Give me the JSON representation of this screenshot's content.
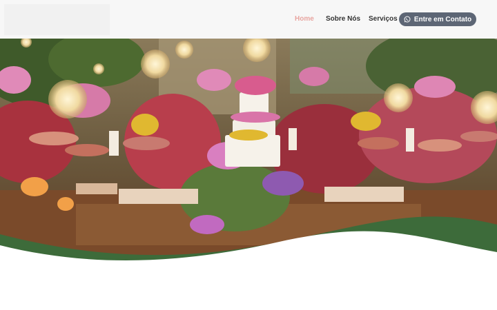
{
  "header": {
    "logo_alt": "",
    "nav": {
      "home": "Home",
      "about": "Sobre Nós",
      "services": "Serviços"
    },
    "cta_label": "Entre em Contato",
    "cta_icon": "whatsapp-icon"
  },
  "hero": {
    "image_description_icon": "event-table-photo",
    "wave_color": "#3d6b3a"
  },
  "colors": {
    "nav_active": "#e8a5a0",
    "nav_text": "#333333",
    "cta_bg": "#5d6675",
    "header_bg": "#f7f7f7"
  }
}
